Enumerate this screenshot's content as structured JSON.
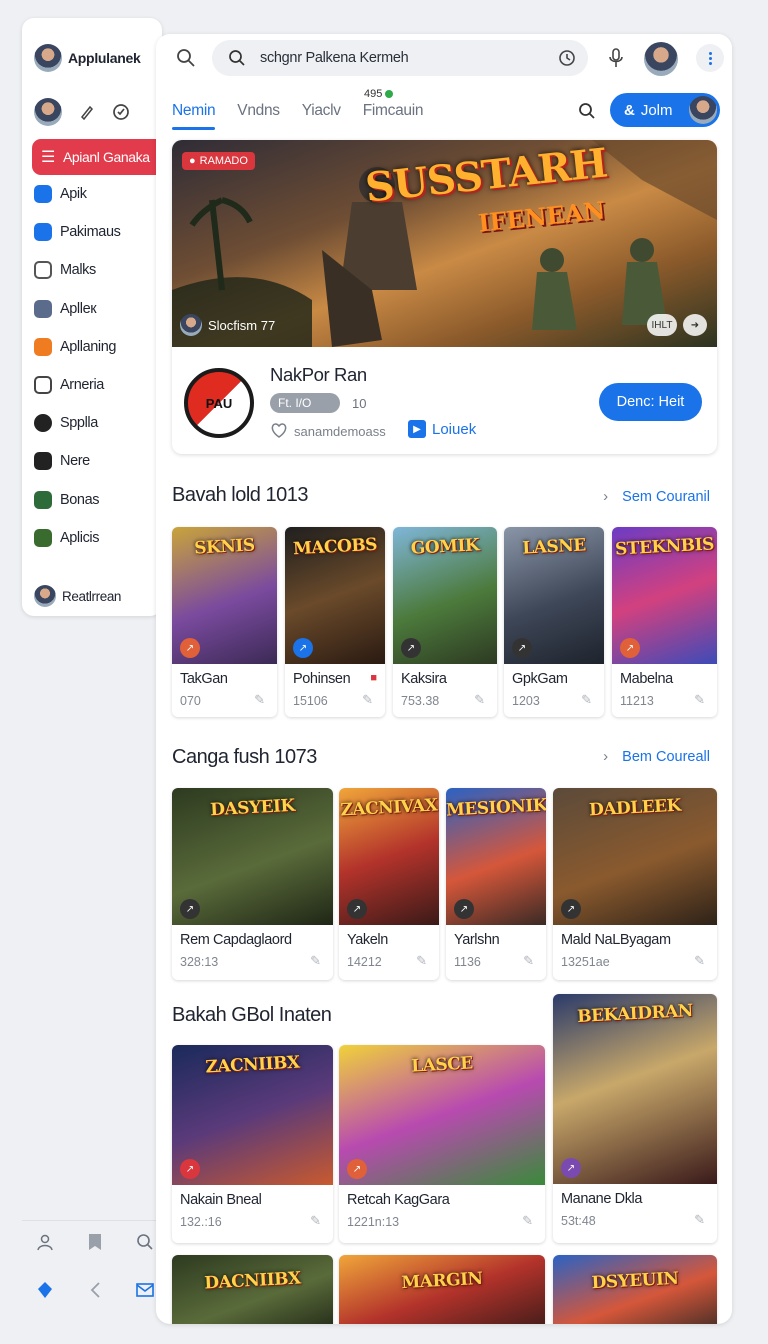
{
  "sidebar": {
    "title": "Applulanek",
    "active_label": "Apianl Ganaka",
    "items": [
      {
        "label": "Apik",
        "icon": "bird-icon",
        "color": "#1a73e8"
      },
      {
        "label": "Pakimaus",
        "icon": "person-icon",
        "color": "#1a73e8"
      },
      {
        "label": "Malks",
        "icon": "square-icon",
        "color": "#555555"
      },
      {
        "label": "Aplleк",
        "icon": "avatar-icon",
        "color": "#5b6b8c"
      },
      {
        "label": "Apllaning",
        "icon": "orange-square-icon",
        "color": "#f07c21"
      },
      {
        "label": "Arneria",
        "icon": "doc-icon",
        "color": "#444444"
      },
      {
        "label": "Spplla",
        "icon": "circle-icon",
        "color": "#222222"
      },
      {
        "label": "Nere",
        "icon": "black-square-icon",
        "color": "#222222"
      },
      {
        "label": "Bonas",
        "icon": "game-icon",
        "color": "#2e6b3a"
      },
      {
        "label": "Aplicis",
        "icon": "leaf-icon",
        "color": "#3a6b2e"
      }
    ],
    "user_label": "Reatlrrean"
  },
  "search": {
    "value": "schgnr Palkena Kermeh"
  },
  "tabs": [
    {
      "label": "Nemin",
      "active": true
    },
    {
      "label": "Vndns",
      "active": false
    },
    {
      "label": "Yiaclv",
      "active": false
    },
    {
      "label": "Fimcauin",
      "active": false
    }
  ],
  "tab_badge": "495",
  "join_label": "Jolm",
  "hero": {
    "badge": "RAMADO",
    "title_line1": "SUSSTARH",
    "title_line2": "IFENEAN",
    "footer": "Slocfism 77",
    "ctrl_label": "IHLT"
  },
  "featured": {
    "logo_text": "PAU",
    "name": "NakPor Ran",
    "rating_pill": "Ft. I/O",
    "rating_count": "10",
    "meta": "sanamdemoass",
    "link_label": "Loiuek",
    "cta": "Denc: Heit"
  },
  "sections": [
    {
      "title": "Bavah lold 1013",
      "link": "Sem Couranil",
      "cards": [
        {
          "name": "TakGan",
          "count": "070",
          "art": "SKNIS",
          "badge_color": "#e0603a",
          "flag": ""
        },
        {
          "name": "Pohinsen",
          "count": "15106",
          "art": "MACOBS",
          "badge_color": "#1a73e8",
          "flag": "■"
        },
        {
          "name": "Kaksira",
          "count": "753.38",
          "art": "GOMIK",
          "badge_color": "#333333",
          "flag": ""
        },
        {
          "name": "GpkGam",
          "count": "1203",
          "art": "LASNE",
          "badge_color": "#333333",
          "flag": ""
        },
        {
          "name": "Mabelna",
          "count": "11213",
          "art": "STEKNBIS",
          "badge_color": "#e0603a",
          "flag": ""
        }
      ]
    },
    {
      "title": "Canga fush 1073",
      "link": "Bem Coureall",
      "cards": [
        {
          "name": "Rem Capdaglaord",
          "count": "328:13",
          "art": "DASYEIK",
          "badge_color": "#333333"
        },
        {
          "name": "Yakeln",
          "count": "14212",
          "art": "ZACNIVAX",
          "badge_color": "#333333"
        },
        {
          "name": "Yarlshn",
          "count": "1136",
          "art": "MESIONIK",
          "badge_color": "#333333"
        },
        {
          "name": "Mald NaLByagam",
          "count": "13251ae",
          "art": "DADLEEK",
          "badge_color": "#333333"
        }
      ]
    },
    {
      "title": "Bakah GBol Inaten",
      "link": "",
      "cards": [
        {
          "name": "Nakain Bneal",
          "count": "132.:16",
          "art": "ZACNIIBX",
          "badge_color": "#d9363e"
        },
        {
          "name": "Retcah KagGara",
          "count": "1221n:13",
          "art": "LASCE",
          "badge_color": "#e0603a"
        },
        {
          "name": "Manane Dkla",
          "count": "53t:48",
          "art": "BEKAIDRAN",
          "badge_color": "#7a4ab0"
        }
      ]
    }
  ],
  "bottom_row": [
    {
      "art": "DACNIIBX"
    },
    {
      "art": "MARGIN"
    },
    {
      "art": "DSYEUIN"
    }
  ],
  "colors": {
    "accent": "#1a73e8",
    "danger": "#e23b4b"
  }
}
